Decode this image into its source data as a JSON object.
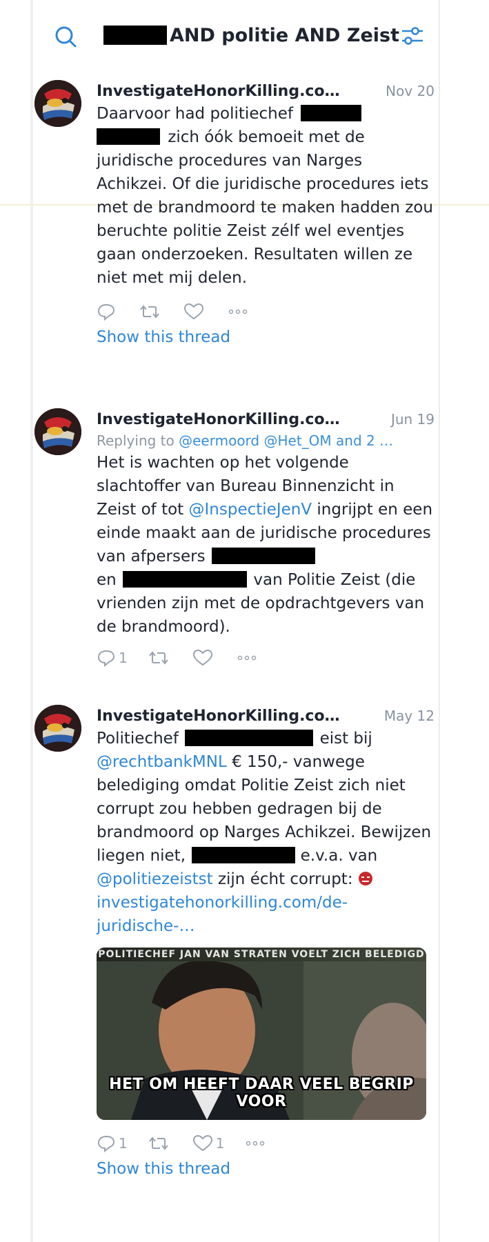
{
  "search": {
    "query_suffix": "AND politie AND Zeist"
  },
  "tweets": [
    {
      "author": "InvestigateHonorKilling.co…",
      "date": "Nov 20",
      "text": {
        "p1": "Daarvoor had politiechef",
        "p2": "zich óók bemoeit met de juridische procedures van Narges Achikzei. Of die juridische procedures iets met de brandmoord te maken hadden zou beruchte politie Zeist zélf wel eventjes gaan onderzoeken. Resultaten willen ze niet met mij delen."
      },
      "reply_count": "",
      "retweet_count": "",
      "like_count": "",
      "thread_label": "Show this thread"
    },
    {
      "author": "InvestigateHonorKilling.co…",
      "date": "Jun 19",
      "replying_prefix": "Replying to",
      "replying_mentions": "@eermoord @Het_OM and 2 …",
      "text": {
        "p1": "Het is wachten op het volgende slachtoffer van Bureau Binnenzicht in Zeist of tot",
        "link1": "@InspectieJenV",
        "p2": "ingrijpt en een einde maakt aan de juridische procedures van afpersers",
        "p3": "en",
        "p4": "van Politie Zeist (die vrienden zijn met de opdrachtgevers van de brandmoord)."
      },
      "reply_count": "1",
      "retweet_count": "",
      "like_count": ""
    },
    {
      "author": "InvestigateHonorKilling.co…",
      "date": "May 12",
      "text": {
        "p1": "Politiechef",
        "p2": "eist bij",
        "link1": "@rechtbankMNL",
        "p3": "€ 150,- vanwege belediging omdat Politie Zeist zich niet corrupt zou hebben gedragen bij de brandmoord op Narges Achikzei. Bewijzen liegen niet,",
        "p4": "e.v.a. van",
        "link2": "@politiezeistst",
        "p5": "zijn écht corrupt:",
        "url": "investigatehonorkilling.com/de-juridische-…"
      },
      "media": {
        "top_text": "POLITIECHEF JAN VAN STRATEN VOELT ZICH BELEDIGD",
        "caption": "HET OM HEEFT DAAR VEEL BEGRIP VOOR"
      },
      "reply_count": "1",
      "retweet_count": "",
      "like_count": "1",
      "thread_label": "Show this thread"
    }
  ],
  "colors": {
    "link": "#2f86d6",
    "text": "#1f2430",
    "muted": "#8893a0"
  },
  "icons": [
    "search-icon",
    "filter-icon",
    "reply-icon",
    "retweet-icon",
    "like-icon",
    "more-icon",
    "angry-emoji-icon"
  ]
}
